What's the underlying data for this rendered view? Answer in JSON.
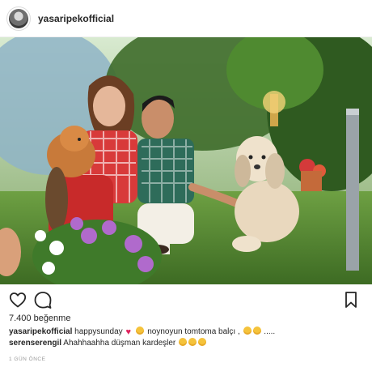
{
  "header": {
    "username": "yasaripekofficial",
    "avatar_icon": "profile-avatar"
  },
  "photo": {
    "description_icon": "couple-with-dogs-photo"
  },
  "actions": {
    "like_icon": "heart-outline-icon",
    "comment_icon": "speech-bubble-icon",
    "save_icon": "bookmark-icon"
  },
  "likes": {
    "text": "7.400 beğenme"
  },
  "caption": {
    "comment1": {
      "username": "yasaripekofficial",
      "text_part1": "happysunday",
      "text_part2": "noynoyun tomtoma balçı ,",
      "text_part3": "....."
    },
    "comment2": {
      "username": "serenserengil",
      "text": "Ahahhaahha düşman kardeşler"
    }
  },
  "timeago": "1 GÜN ÖNCE",
  "colors": {
    "accent_heart": "#e0245e",
    "text": "#262626",
    "muted": "#999999"
  }
}
